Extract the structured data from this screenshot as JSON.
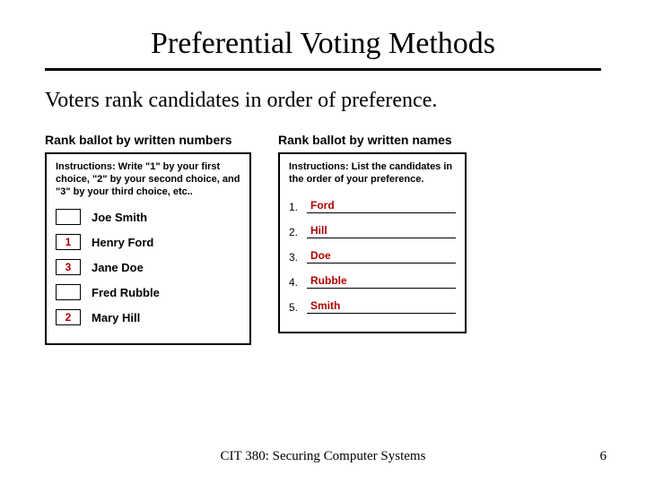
{
  "title": "Preferential Voting Methods",
  "subtitle": "Voters rank candidates in order of preference.",
  "ballot_numbers": {
    "heading": "Rank ballot by written numbers",
    "instructions": "Instructions: Write \"1\" by your first choice, \"2\" by your second choice, and \"3\" by your third choice, etc..",
    "rows": [
      {
        "rank": "",
        "candidate": "Joe Smith"
      },
      {
        "rank": "1",
        "candidate": "Henry Ford"
      },
      {
        "rank": "3",
        "candidate": "Jane Doe"
      },
      {
        "rank": "",
        "candidate": "Fred Rubble"
      },
      {
        "rank": "2",
        "candidate": "Mary Hill"
      }
    ]
  },
  "ballot_names": {
    "heading": "Rank ballot by written names",
    "instructions": "Instructions: List the candidates in the order of your preference.",
    "rows": [
      {
        "ord": "1.",
        "name": "Ford"
      },
      {
        "ord": "2.",
        "name": "Hill"
      },
      {
        "ord": "3.",
        "name": "Doe"
      },
      {
        "ord": "4.",
        "name": "Rubble"
      },
      {
        "ord": "5.",
        "name": "Smith"
      }
    ]
  },
  "footer": "CIT 380: Securing Computer Systems",
  "page_number": "6"
}
